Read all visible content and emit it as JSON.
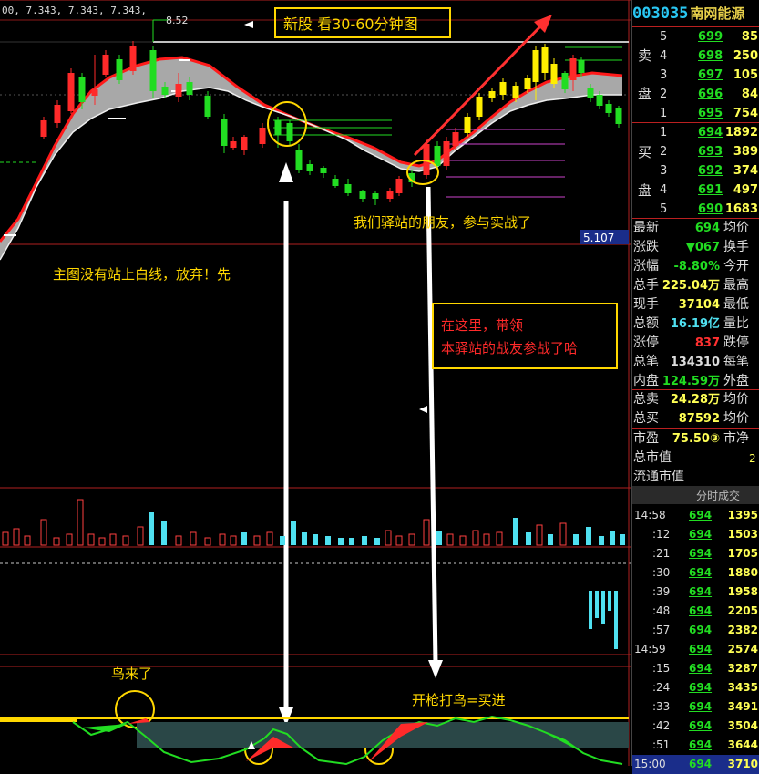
{
  "chart": {
    "indicator_readout": "00, 7.343, 7.343, 7.343,",
    "peak_price_label": "8.52",
    "right_price_tag": "5.107",
    "banner": "新股  看30-60分钟图",
    "annotations": {
      "friends_joined": "我们驿站的朋友，参与实战了",
      "main_chart_note": "主图没有站上白线，放弃！先",
      "here_line1": "在这里，带领",
      "here_line2": "本驿站的战友参战了哈",
      "bird_came": "鸟来了",
      "shoot_bird": "开枪打鸟=买进"
    },
    "colors": {
      "rise": "#ff2a2a",
      "fall": "#22dd22",
      "yellow": "#ffd700",
      "cyan": "#4fe0f0",
      "band": "#a8a8a8"
    }
  },
  "panel": {
    "code": "003035",
    "code_prefix": "00",
    "name": "南网能源",
    "sell_label": [
      "卖",
      "盘"
    ],
    "buy_label": [
      "买",
      "盘"
    ],
    "sell": [
      {
        "level": "5",
        "price": "699",
        "vol": "85"
      },
      {
        "level": "4",
        "price": "698",
        "vol": "250"
      },
      {
        "level": "3",
        "price": "697",
        "vol": "105"
      },
      {
        "level": "2",
        "price": "696",
        "vol": "84"
      },
      {
        "level": "1",
        "price": "695",
        "vol": "754"
      }
    ],
    "buy": [
      {
        "level": "1",
        "price": "694",
        "vol": "1892"
      },
      {
        "level": "2",
        "price": "693",
        "vol": "389"
      },
      {
        "level": "3",
        "price": "692",
        "vol": "374"
      },
      {
        "level": "4",
        "price": "691",
        "vol": "497"
      },
      {
        "level": "5",
        "price": "690",
        "vol": "1683"
      }
    ],
    "stats": [
      {
        "l1": "最新",
        "v1": "694",
        "c1": "#22dd22",
        "l2": "均价"
      },
      {
        "l1": "涨跌",
        "v1": "▼067",
        "c1": "#22dd22",
        "l2": "换手"
      },
      {
        "l1": "涨幅",
        "v1": "-8.80%",
        "c1": "#22dd22",
        "l2": "今开"
      },
      {
        "l1": "总手",
        "v1": "225.04万",
        "c1": "#ffff55",
        "l2": "最高"
      },
      {
        "l1": "现手",
        "v1": "37104",
        "c1": "#ffff55",
        "l2": "最低"
      },
      {
        "l1": "总额",
        "v1": "16.19亿",
        "c1": "#4fe0f0",
        "l2": "量比"
      },
      {
        "l1": "涨停",
        "v1": "837",
        "c1": "#ff3030",
        "l2": "跌停"
      },
      {
        "l1": "总笔",
        "v1": "134310",
        "c1": "#dddddd",
        "l2": "每笔"
      },
      {
        "l1": "内盘",
        "v1": "124.59万",
        "c1": "#22dd22",
        "l2": "外盘"
      }
    ],
    "stats2": [
      {
        "l1": "总卖",
        "v1": "24.28万",
        "c1": "#ffff55",
        "l2": "均价"
      },
      {
        "l1": "总买",
        "v1": "87592",
        "c1": "#ffff55",
        "l2": "均价"
      }
    ],
    "stats3": [
      {
        "l1": "市盈",
        "v1": "75.50③",
        "c1": "#ffff55",
        "l2": "市净"
      },
      {
        "l1": "总市值",
        "v1": "",
        "c1": "#ffff55",
        "l2": ""
      },
      {
        "l1": "流通市值",
        "v1": "",
        "c1": "#ffff55",
        "l2": ""
      }
    ],
    "mini_value": "2",
    "ticks_title": "分时成交",
    "ticks": [
      {
        "time": "14:58",
        "price": "694",
        "vol": "1395"
      },
      {
        "time": ":12",
        "price": "694",
        "vol": "1503"
      },
      {
        "time": ":21",
        "price": "694",
        "vol": "1705"
      },
      {
        "time": ":30",
        "price": "694",
        "vol": "1880"
      },
      {
        "time": ":39",
        "price": "694",
        "vol": "1958"
      },
      {
        "time": ":48",
        "price": "694",
        "vol": "2205"
      },
      {
        "time": ":57",
        "price": "694",
        "vol": "2382"
      },
      {
        "time": "14:59",
        "price": "694",
        "vol": "2574"
      },
      {
        "time": ":15",
        "price": "694",
        "vol": "3287"
      },
      {
        "time": ":24",
        "price": "694",
        "vol": "3435"
      },
      {
        "time": ":33",
        "price": "694",
        "vol": "3491"
      },
      {
        "time": ":42",
        "price": "694",
        "vol": "3504"
      },
      {
        "time": ":51",
        "price": "694",
        "vol": "3644"
      },
      {
        "time": "15:00",
        "price": "694",
        "vol": "3710"
      }
    ]
  }
}
